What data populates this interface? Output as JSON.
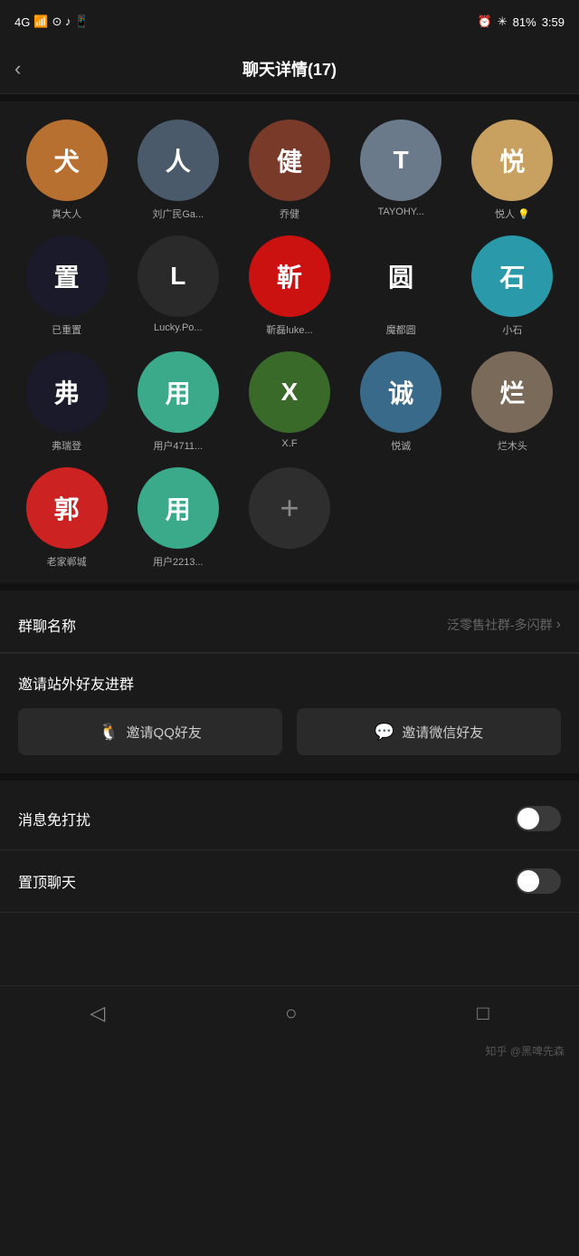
{
  "statusBar": {
    "signal": "4G",
    "time": "3:59",
    "battery": "81%",
    "batteryIcon": "🔋"
  },
  "header": {
    "backLabel": "‹",
    "title": "聊天详情(17)"
  },
  "members": [
    {
      "id": 1,
      "name": "真大人",
      "color": "#c8883a",
      "initials": "犬",
      "bg": "#b87030"
    },
    {
      "id": 2,
      "name": "刘广民Ga...",
      "color": "#5a6a7a",
      "initials": "人",
      "bg": "#4a5a6a"
    },
    {
      "id": 3,
      "name": "乔健",
      "color": "#8a4a3a",
      "initials": "健",
      "bg": "#7a3a2a"
    },
    {
      "id": 4,
      "name": "TAYOHY...",
      "color": "#7a8a9a",
      "initials": "T",
      "bg": "#6a7a8a"
    },
    {
      "id": 5,
      "name": "悦人 💡",
      "color": "#c8a87a",
      "initials": "悦",
      "bg": "#b89868"
    },
    {
      "id": 6,
      "name": "已重置",
      "color": "#3a3a3a",
      "initials": "置",
      "bg": "#2a2a2a"
    },
    {
      "id": 7,
      "name": "Lucky.Po...",
      "color": "#2a2a2a",
      "initials": "L",
      "bg": "#1a1a1a"
    },
    {
      "id": 8,
      "name": "靳磊luke...",
      "color": "#cc2222",
      "initials": "靳",
      "bg": "#cc2222"
    },
    {
      "id": 9,
      "name": "魔都圆",
      "color": "#2a2a2a",
      "initials": "圆",
      "bg": "#1a1a1a"
    },
    {
      "id": 10,
      "name": "小石",
      "color": "#3a8aaa",
      "initials": "石",
      "bg": "#2a7a9a"
    },
    {
      "id": 11,
      "name": "弗瑞登",
      "color": "#3a3a3a",
      "initials": "弗",
      "bg": "#2a2a2a"
    },
    {
      "id": 12,
      "name": "用户4711...",
      "color": "#3aaa8a",
      "initials": "用",
      "bg": "#2a9a7a"
    },
    {
      "id": 13,
      "name": "X.F",
      "color": "#4a6a3a",
      "initials": "X",
      "bg": "#3a5a2a"
    },
    {
      "id": 14,
      "name": "悦诚",
      "color": "#5a7a9a",
      "initials": "诚",
      "bg": "#4a6a8a"
    },
    {
      "id": 15,
      "name": "烂木头",
      "color": "#8a7a6a",
      "initials": "烂",
      "bg": "#7a6a5a"
    },
    {
      "id": 16,
      "name": "老家郸城",
      "color": "#cc2222",
      "initials": "郭",
      "bg": "#cc2222"
    },
    {
      "id": 17,
      "name": "用户2213...",
      "color": "#3aaa8a",
      "initials": "用",
      "bg": "#2a9a7a"
    }
  ],
  "addButton": {
    "label": "+"
  },
  "groupName": {
    "label": "群聊名称",
    "value": "泛零售社群-多闪群",
    "chevron": "›"
  },
  "inviteSection": {
    "title": "邀请站外好友进群",
    "qqButton": "邀请QQ好友",
    "wechatButton": "邀请微信好友",
    "qqIcon": "🐧",
    "wechatIcon": "💬"
  },
  "toggleRows": [
    {
      "id": "mute",
      "label": "消息免打扰",
      "on": false
    },
    {
      "id": "pin",
      "label": "置顶聊天",
      "on": false
    }
  ],
  "bottomNav": {
    "items": [
      "◁",
      "○",
      "□"
    ],
    "credit": "知乎 @黑啤先森"
  }
}
